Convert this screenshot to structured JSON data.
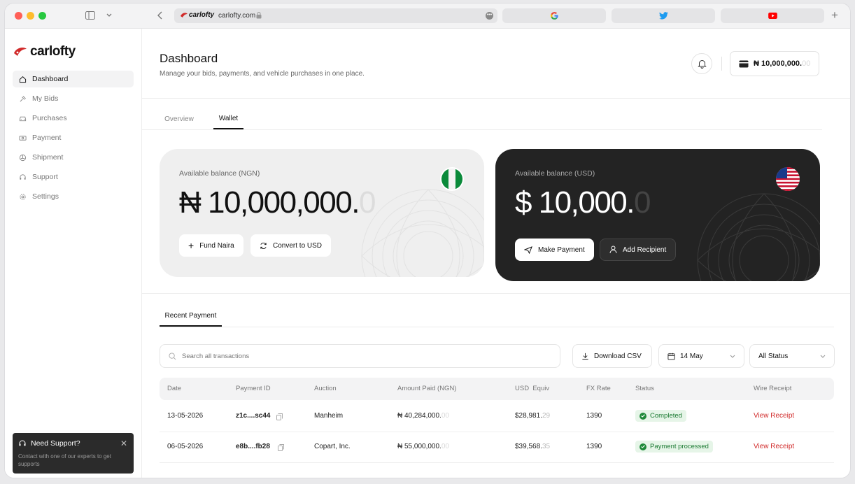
{
  "browser": {
    "url": "carlofty.com",
    "brand_small": "carlofty"
  },
  "sidebar": {
    "brand": "carlofty",
    "items": [
      {
        "label": "Dashboard",
        "icon": "home-icon"
      },
      {
        "label": "My Bids",
        "icon": "gavel-icon"
      },
      {
        "label": "Purchases",
        "icon": "car-icon"
      },
      {
        "label": "Payment",
        "icon": "money-icon"
      },
      {
        "label": "Shipment",
        "icon": "ship-icon"
      },
      {
        "label": "Support",
        "icon": "headset-icon"
      },
      {
        "label": "Settings",
        "icon": "gear-icon"
      }
    ],
    "support": {
      "title": "Need Support?",
      "desc": "Contact with one of our experts to get supports"
    }
  },
  "header": {
    "title": "Dashboard",
    "subtitle": "Manage your bids, payments, and vehicle purchases in one place.",
    "balance_main": "₦ 10,000,000.",
    "balance_fade": "00"
  },
  "tabs": [
    {
      "label": "Overview"
    },
    {
      "label": "Wallet"
    }
  ],
  "wallets": {
    "ngn": {
      "label": "Available balance (NGN)",
      "amount": "₦ 10,000,000.",
      "amount_fade": "0",
      "btn_fund": "Fund Naira",
      "btn_convert": "Convert to USD"
    },
    "usd": {
      "label": "Available balance (USD)",
      "amount": "$ 10,000.",
      "amount_fade": "0",
      "btn_pay": "Make Payment",
      "btn_recipient": "Add Recipient"
    }
  },
  "recent": {
    "tab": "Recent Payment",
    "search_placeholder": "Search all transactions",
    "download": "Download CSV",
    "date_filter": "14 May",
    "status_filter": "All Status",
    "columns": [
      "Date",
      "Payment ID",
      "Auction",
      "Amount Paid (NGN)",
      "USD  Equiv",
      "FX Rate",
      "Status",
      "Wire Receipt"
    ],
    "rows": [
      {
        "date": "13-05-2026",
        "id": "z1c....sc44",
        "auction": "Manheim",
        "amount": "₦ 40,284,000.",
        "amount_fade": "00",
        "usd": "$28,981.",
        "usd_fade": "29",
        "fx": "1390",
        "status": "Completed",
        "receipt": "View Receipt"
      },
      {
        "date": "06-05-2026",
        "id": "e8b....fb28",
        "auction": "Copart, Inc.",
        "amount": "₦ 55,000,000.",
        "amount_fade": "00",
        "usd": "$39,568.",
        "usd_fade": "35",
        "fx": "1390",
        "status": "Payment processed",
        "receipt": "View Receipt"
      }
    ]
  },
  "colors": {
    "accent": "#d12a2a",
    "dark_card": "#232323",
    "light_card": "#efefef",
    "success": "#1f8a3a"
  }
}
